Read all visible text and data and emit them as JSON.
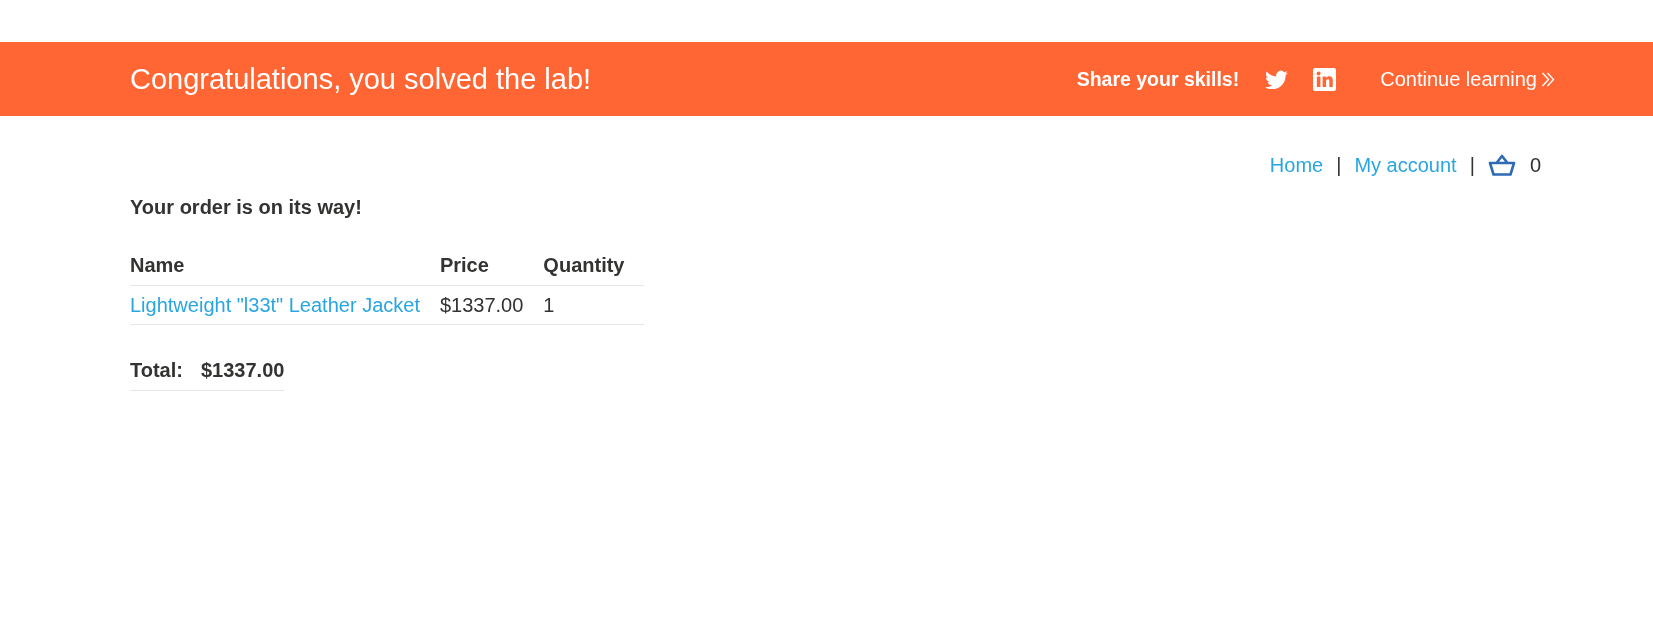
{
  "banner": {
    "message": "Congratulations, you solved the lab!",
    "share_label": "Share your skills!",
    "continue_link": "Continue learning"
  },
  "nav": {
    "items": [
      {
        "kind": "link",
        "label": "Home"
      },
      {
        "kind": "separator",
        "label": "|"
      },
      {
        "kind": "link",
        "label": "My account"
      },
      {
        "kind": "separator",
        "label": "|"
      },
      {
        "kind": "cart",
        "count": "0"
      }
    ]
  },
  "heading": "Your order is on its way!",
  "table": {
    "columns": [
      "Name",
      "Price",
      "Quantity"
    ],
    "rows": [
      {
        "name": "Lightweight \"l33t\" Leather Jacket",
        "price": "$1337.00",
        "quantity": "1"
      }
    ]
  },
  "total": {
    "label": "Total:",
    "value": "$1337.00"
  }
}
